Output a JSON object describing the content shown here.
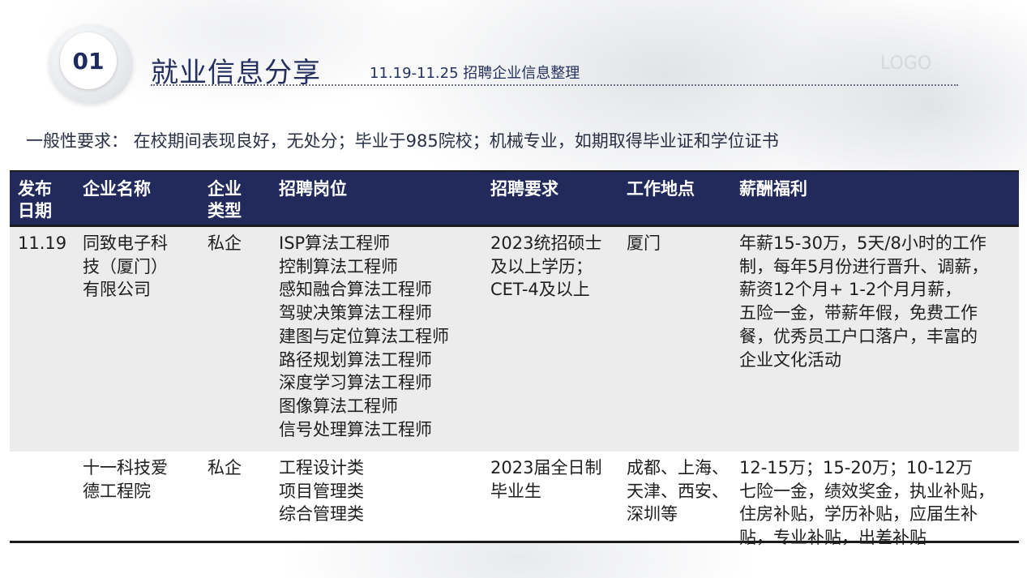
{
  "header": {
    "number": "01",
    "title": "就业信息分享",
    "subtitle": "11.19-11.25 招聘企业信息整理",
    "logo": "LOGO"
  },
  "requirement": "一般性要求： 在校期间表现良好，无处分；毕业于985院校；机械专业，如期取得毕业证和学位证书",
  "table": {
    "headers": {
      "date": [
        "发布",
        "日期"
      ],
      "company": [
        "企业名称"
      ],
      "type": [
        "企业",
        "类型"
      ],
      "positions": [
        "招聘岗位"
      ],
      "requirements": [
        "招聘要求"
      ],
      "location": [
        "工作地点"
      ],
      "benefits": [
        "薪酬福利"
      ]
    },
    "rows": [
      {
        "date": [
          "11.19"
        ],
        "company": [
          "同致电子科",
          "技（厦门）",
          "有限公司"
        ],
        "type": [
          "私企"
        ],
        "positions": [
          "ISP算法工程师",
          "控制算法工程师",
          "感知融合算法工程师",
          "驾驶决策算法工程师",
          "建图与定位算法工程师",
          "路径规划算法工程师",
          "深度学习算法工程师",
          "图像算法工程师",
          "信号处理算法工程师"
        ],
        "requirements": [
          "2023统招硕士",
          "及以上学历；",
          "CET-4及以上"
        ],
        "location": [
          "厦门"
        ],
        "benefits": [
          "年薪15-30万，5天/8小时的工作",
          "制，每年5月份进行晋升、调薪，",
          "薪资12个月+ 1-2个月月薪，",
          "五险一金，带薪年假，免费工作",
          "餐，优秀员工户口落户，丰富的",
          "企业文化活动"
        ]
      },
      {
        "date": [],
        "company": [
          "十一科技爱",
          "德工程院"
        ],
        "type": [
          "私企"
        ],
        "positions": [
          "工程设计类",
          "项目管理类",
          "综合管理类"
        ],
        "requirements": [
          "2023届全日制",
          "毕业生"
        ],
        "location": [
          "成都、上海、",
          "天津、西安、",
          "深圳等"
        ],
        "benefits": [
          "12-15万；15-20万；10-12万",
          "七险一金，绩效奖金，执业补贴，",
          "住房补贴，学历补贴，应届生补",
          "贴，专业补贴，出差补贴"
        ]
      }
    ]
  }
}
